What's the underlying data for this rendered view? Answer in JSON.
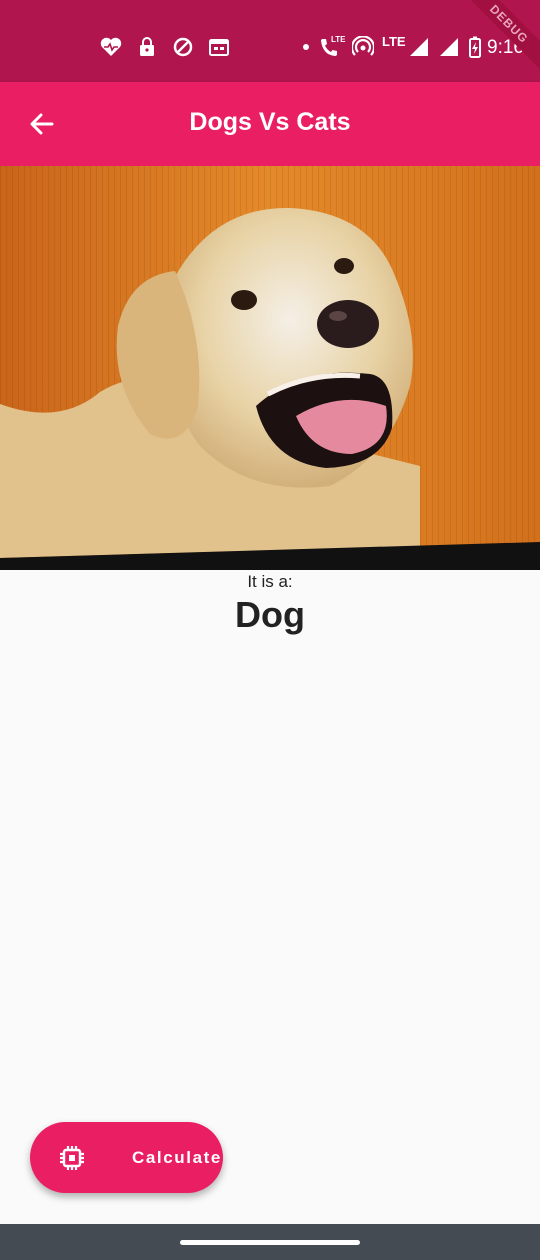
{
  "status_bar": {
    "time": "9:16",
    "debug_banner": "DEBUG",
    "lte_label": "LTE",
    "left_icons": [
      "health-icon",
      "lock-icon",
      "vpn-icon",
      "calendar-icon"
    ],
    "right_icons": [
      "notification-dot-icon",
      "volte-call-icon",
      "hotspot-icon",
      "lte-icon",
      "signal-icon",
      "signal-icon",
      "battery-charging-icon"
    ]
  },
  "app_bar": {
    "title": "Dogs Vs Cats",
    "back_icon": "arrow-back-icon",
    "color": "#e91e63"
  },
  "result": {
    "caption": "It is a:",
    "label": "Dog"
  },
  "fab": {
    "label": "Calculate",
    "icon": "memory-chip-icon",
    "color": "#e91e63"
  },
  "colors": {
    "status_bar": "#b0154d",
    "background": "#fafafa",
    "nav_bar": "#444b52"
  }
}
